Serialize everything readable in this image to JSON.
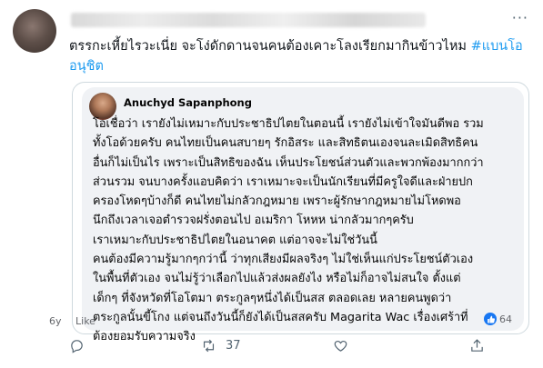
{
  "tweet": {
    "author_name_blurred": "",
    "text": "ตรรกะเหี้ยไรวะเนี่ย จะโง่ดักดานจนคนต้องเคาะโลงเรียกมากินข้าวไหม ",
    "hashtag": "#แบนโออนุชิต"
  },
  "quoted_post": {
    "author": "Anuchyd Sapanphong",
    "lines": [
      "โอเชื่อว่า เรายังไม่เหมาะกับประชาธิปไตยในตอนนี้ เรายังไม่เข้าใจมันดีพอ รวม",
      "ทั้งโอด้วยครับ คนไทยเป็นคนสบายๆ รักอิสระ และสิทธิตนเองจนละเมิดสิทธิคน",
      "อื่นก็ไม่เป็นไร เพราะเป็นสิทธิของฉัน เห็นประโยชน์ส่วนตัวและพวกพ้องมากกว่า",
      "ส่วนรวม จนบางครั้งแอบคิดว่า เราเหมาะจะเป็นนักเรียนที่มีครูใจดีและฝ่ายปก",
      "ครองโหดๆบ้างก็ดี คนไทยไม่กลัวกฎหมาย เพราะผู้รักษากฎหมายไม่โหดพอ",
      "นึกถึงเวลาเจอตำรวจฝรั่งตอนไป อเมริกา โหหห น่ากลัวมากๆครับ",
      "เราเหมาะกับประชาธิปไตยในอนาคต แต่อาจจะไม่ใช่วันนี้",
      "คนต้องมีความรู้มากๆกว่านี้ ว่าทุกเสียงมีผลจริงๆ ไม่ใช่เห็นแก่ประโยชน์ตัวเอง",
      "ในพื้นที่ตัวเอง จนไม่รู้ว่าเลือกไปแล้วส่งผลยังไง หรือไม่ก็อาจไม่สนใจ ตั้งแต่",
      "เด็กๆ ที่จังหวัดที่โอโตมา ตระกูลๆหนึ่งได้เป็นสส ตลอดเลย หลายคนพูดว่า",
      "ตระกูลนั้นขี้โกง แต่จนถึงวันนี้ก็ยังได้เป็นสสครับ Magarita Wac เรื่องเศร้าที่",
      "ต้องยอมรับความจริง"
    ],
    "time": "6y",
    "like_label": "Like",
    "reaction_count": "64"
  },
  "actions": {
    "reply_count": "",
    "retweet_count": "37",
    "like_count": ""
  },
  "colors": {
    "hashtag": "#1d9bf0",
    "fb_like": "#1877f2",
    "border": "#cfd9de"
  }
}
